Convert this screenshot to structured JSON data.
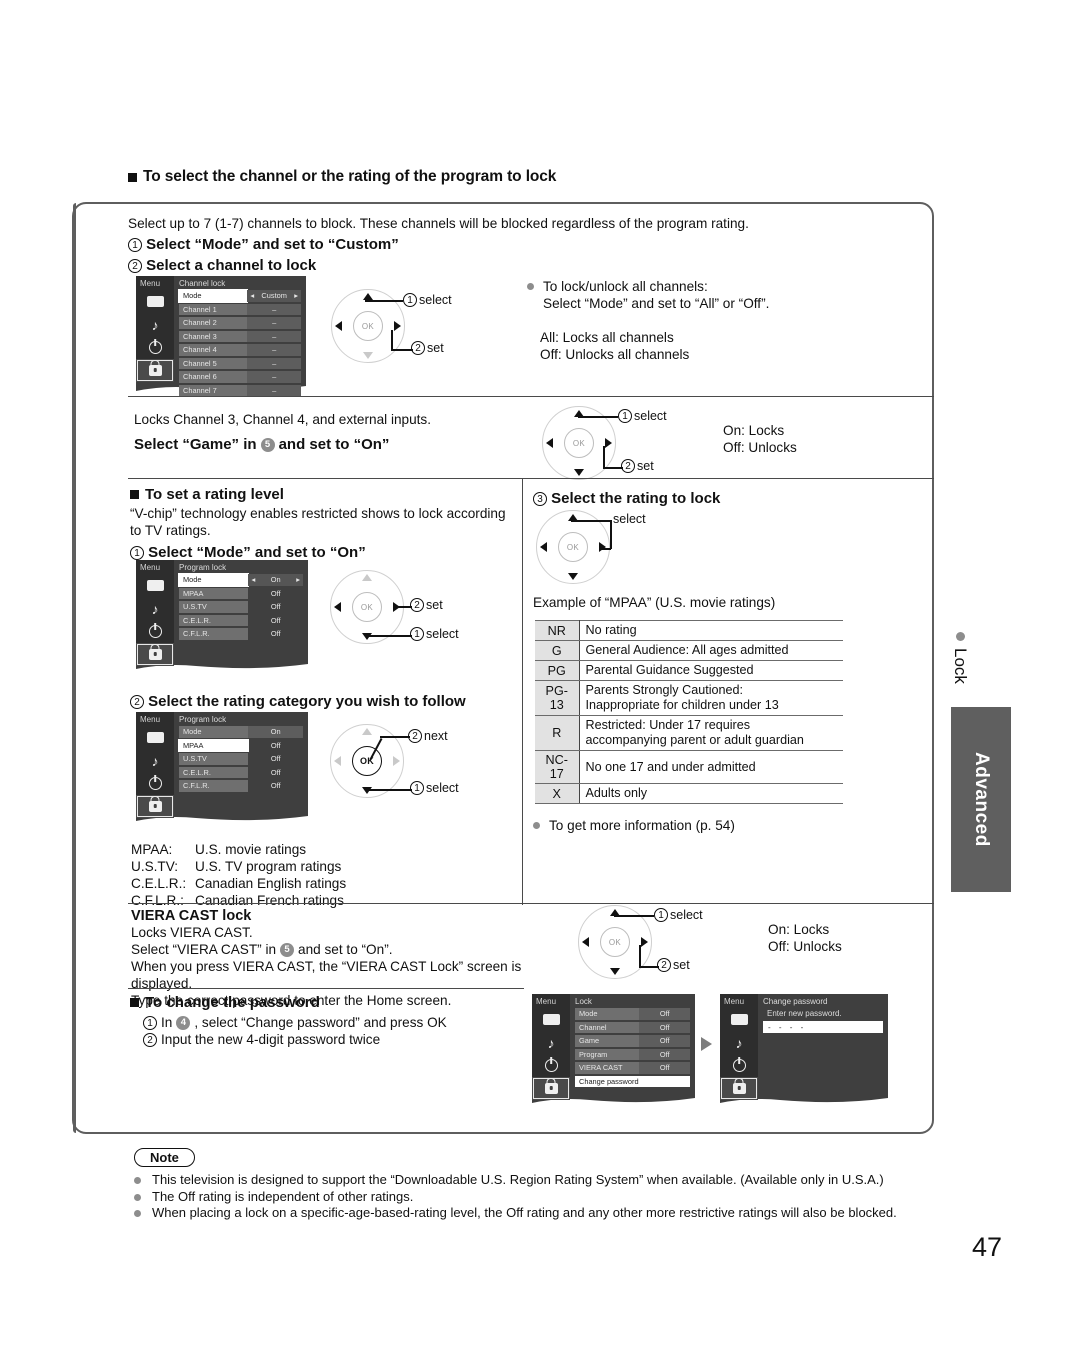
{
  "page": {
    "number": "47",
    "side_tab_lock": "Lock",
    "side_tab_advanced": "Advanced"
  },
  "heading": {
    "title": "To select the channel or the rating of the program to lock"
  },
  "channel_lock": {
    "intro": "Select up to 7 (1-7) channels to block. These channels will be blocked regardless of the program rating.",
    "step1": "Select “Mode” and set to “Custom”",
    "step2": "Select a channel to lock",
    "pad": {
      "label1": "select",
      "label2": "set",
      "ok": "OK"
    },
    "notes": {
      "bullet": "To lock/unlock all channels:",
      "bullet_line2": "Select “Mode” and set to “All” or “Off”.",
      "all": "All:  Locks all channels",
      "off": "Off:  Unlocks all channels"
    },
    "osd": {
      "menu_label": "Menu",
      "title": "Channel lock",
      "mode_key": "Mode",
      "mode_value": "Custom",
      "rows": [
        {
          "key": "Channel 1",
          "value": "–"
        },
        {
          "key": "Channel 2",
          "value": "–"
        },
        {
          "key": "Channel 3",
          "value": "–"
        },
        {
          "key": "Channel 4",
          "value": "–"
        },
        {
          "key": "Channel 5",
          "value": "–"
        },
        {
          "key": "Channel 6",
          "value": "–"
        },
        {
          "key": "Channel 7",
          "value": "–"
        }
      ]
    }
  },
  "game_lock": {
    "line1": "Locks Channel 3, Channel 4, and external inputs.",
    "line2_a": "Select “Game” in",
    "line2_num": "5",
    "line2_b": "and set to “On”",
    "pad": {
      "label1": "select",
      "label2": "set",
      "ok": "OK"
    },
    "on": "On:  Locks",
    "off": "Off:  Unlocks"
  },
  "rating_level": {
    "heading": "To set a rating level",
    "body": "“V-chip” technology enables restricted shows to lock according to TV ratings.",
    "step1": "Select “Mode” and set to “On”",
    "step2": "Select the rating category you wish to follow",
    "step3": "Select the rating to lock",
    "pad1": {
      "label1": "select",
      "label2": "set",
      "ok": "OK"
    },
    "pad2": {
      "label1": "select",
      "label2": "next",
      "ok": "OK"
    },
    "pad3": {
      "label1": "select",
      "ok": "OK"
    },
    "example_caption": "Example of “MPAA” (U.S. movie ratings)",
    "more_info": "To get more information (p. 54)",
    "osd1": {
      "menu_label": "Menu",
      "title": "Program lock",
      "mode_key": "Mode",
      "mode_value": "On",
      "rows": [
        {
          "key": "MPAA",
          "value": "Off"
        },
        {
          "key": "U.S.TV",
          "value": "Off"
        },
        {
          "key": "C.E.L.R.",
          "value": "Off"
        },
        {
          "key": "C.F.L.R.",
          "value": "Off"
        }
      ]
    },
    "osd2": {
      "menu_label": "Menu",
      "title": "Program lock",
      "mode_key": "Mode",
      "mode_value": "On",
      "rows": [
        {
          "key": "MPAA",
          "value": "Off",
          "highlight": true
        },
        {
          "key": "U.S.TV",
          "value": "Off"
        },
        {
          "key": "C.E.L.R.",
          "value": "Off"
        },
        {
          "key": "C.F.L.R.",
          "value": "Off"
        }
      ]
    },
    "mpaa_table": [
      {
        "code": "NR",
        "desc": "No rating"
      },
      {
        "code": "G",
        "desc": "General Audience:  All ages admitted"
      },
      {
        "code": "PG",
        "desc": "Parental Guidance Suggested"
      },
      {
        "code": "PG-\n13",
        "desc": "Parents Strongly Cautioned:\nInappropriate for children under 13"
      },
      {
        "code": "R",
        "desc": "Restricted:  Under 17 requires\naccompanying parent or adult guardian"
      },
      {
        "code": "NC-\n17",
        "desc": "No one 17 and under admitted"
      },
      {
        "code": "X",
        "desc": "Adults only"
      }
    ],
    "legend": [
      {
        "abbr": "MPAA:",
        "text": "U.S. movie ratings"
      },
      {
        "abbr": "U.S.TV:",
        "text": "U.S. TV program ratings"
      },
      {
        "abbr": "C.E.L.R.:",
        "text": "Canadian English ratings"
      },
      {
        "abbr": "C.F.L.R.:",
        "text": "Canadian French ratings"
      }
    ]
  },
  "viera_cast": {
    "heading": "VIERA CAST lock",
    "line1": "Locks VIERA CAST.",
    "line2_a": "Select “VIERA CAST” in",
    "line2_num": "5",
    "line2_b": "and set to “On”.",
    "line3": "When you press VIERA CAST, the “VIERA CAST Lock” screen is displayed.",
    "line4": "Type the correct password to enter the Home screen.",
    "pad": {
      "label1": "select",
      "label2": "set",
      "ok": "OK"
    },
    "on": "On:  Locks",
    "off": "Off:  Unlocks"
  },
  "change_password": {
    "heading": "To change the password",
    "step1_a": "In",
    "step1_num": "4",
    "step1_b": ", select “Change password” and press OK",
    "step2": "Input the new 4-digit password twice",
    "osd_lock": {
      "menu_label": "Menu",
      "title": "Lock",
      "rows": [
        {
          "key": "Mode",
          "value": "Off"
        },
        {
          "key": "Channel",
          "value": "Off"
        },
        {
          "key": "Game",
          "value": "Off"
        },
        {
          "key": "Program",
          "value": "Off"
        },
        {
          "key": "VIERA CAST",
          "value": "Off"
        }
      ],
      "highlight_row": "Change password"
    },
    "osd_change": {
      "menu_label": "Menu",
      "title": "Change password",
      "prompt": "Enter new password.",
      "field_value": "- - - -"
    }
  },
  "note": {
    "label": "Note",
    "items": [
      "This television is designed to support the  “Downloadable U.S. Region Rating System” when available. (Available only in U.S.A.)",
      "The Off rating is independent of other ratings.",
      "When placing a lock on a specific-age-based-rating level, the Off rating and any other more restrictive ratings will also be blocked."
    ]
  }
}
